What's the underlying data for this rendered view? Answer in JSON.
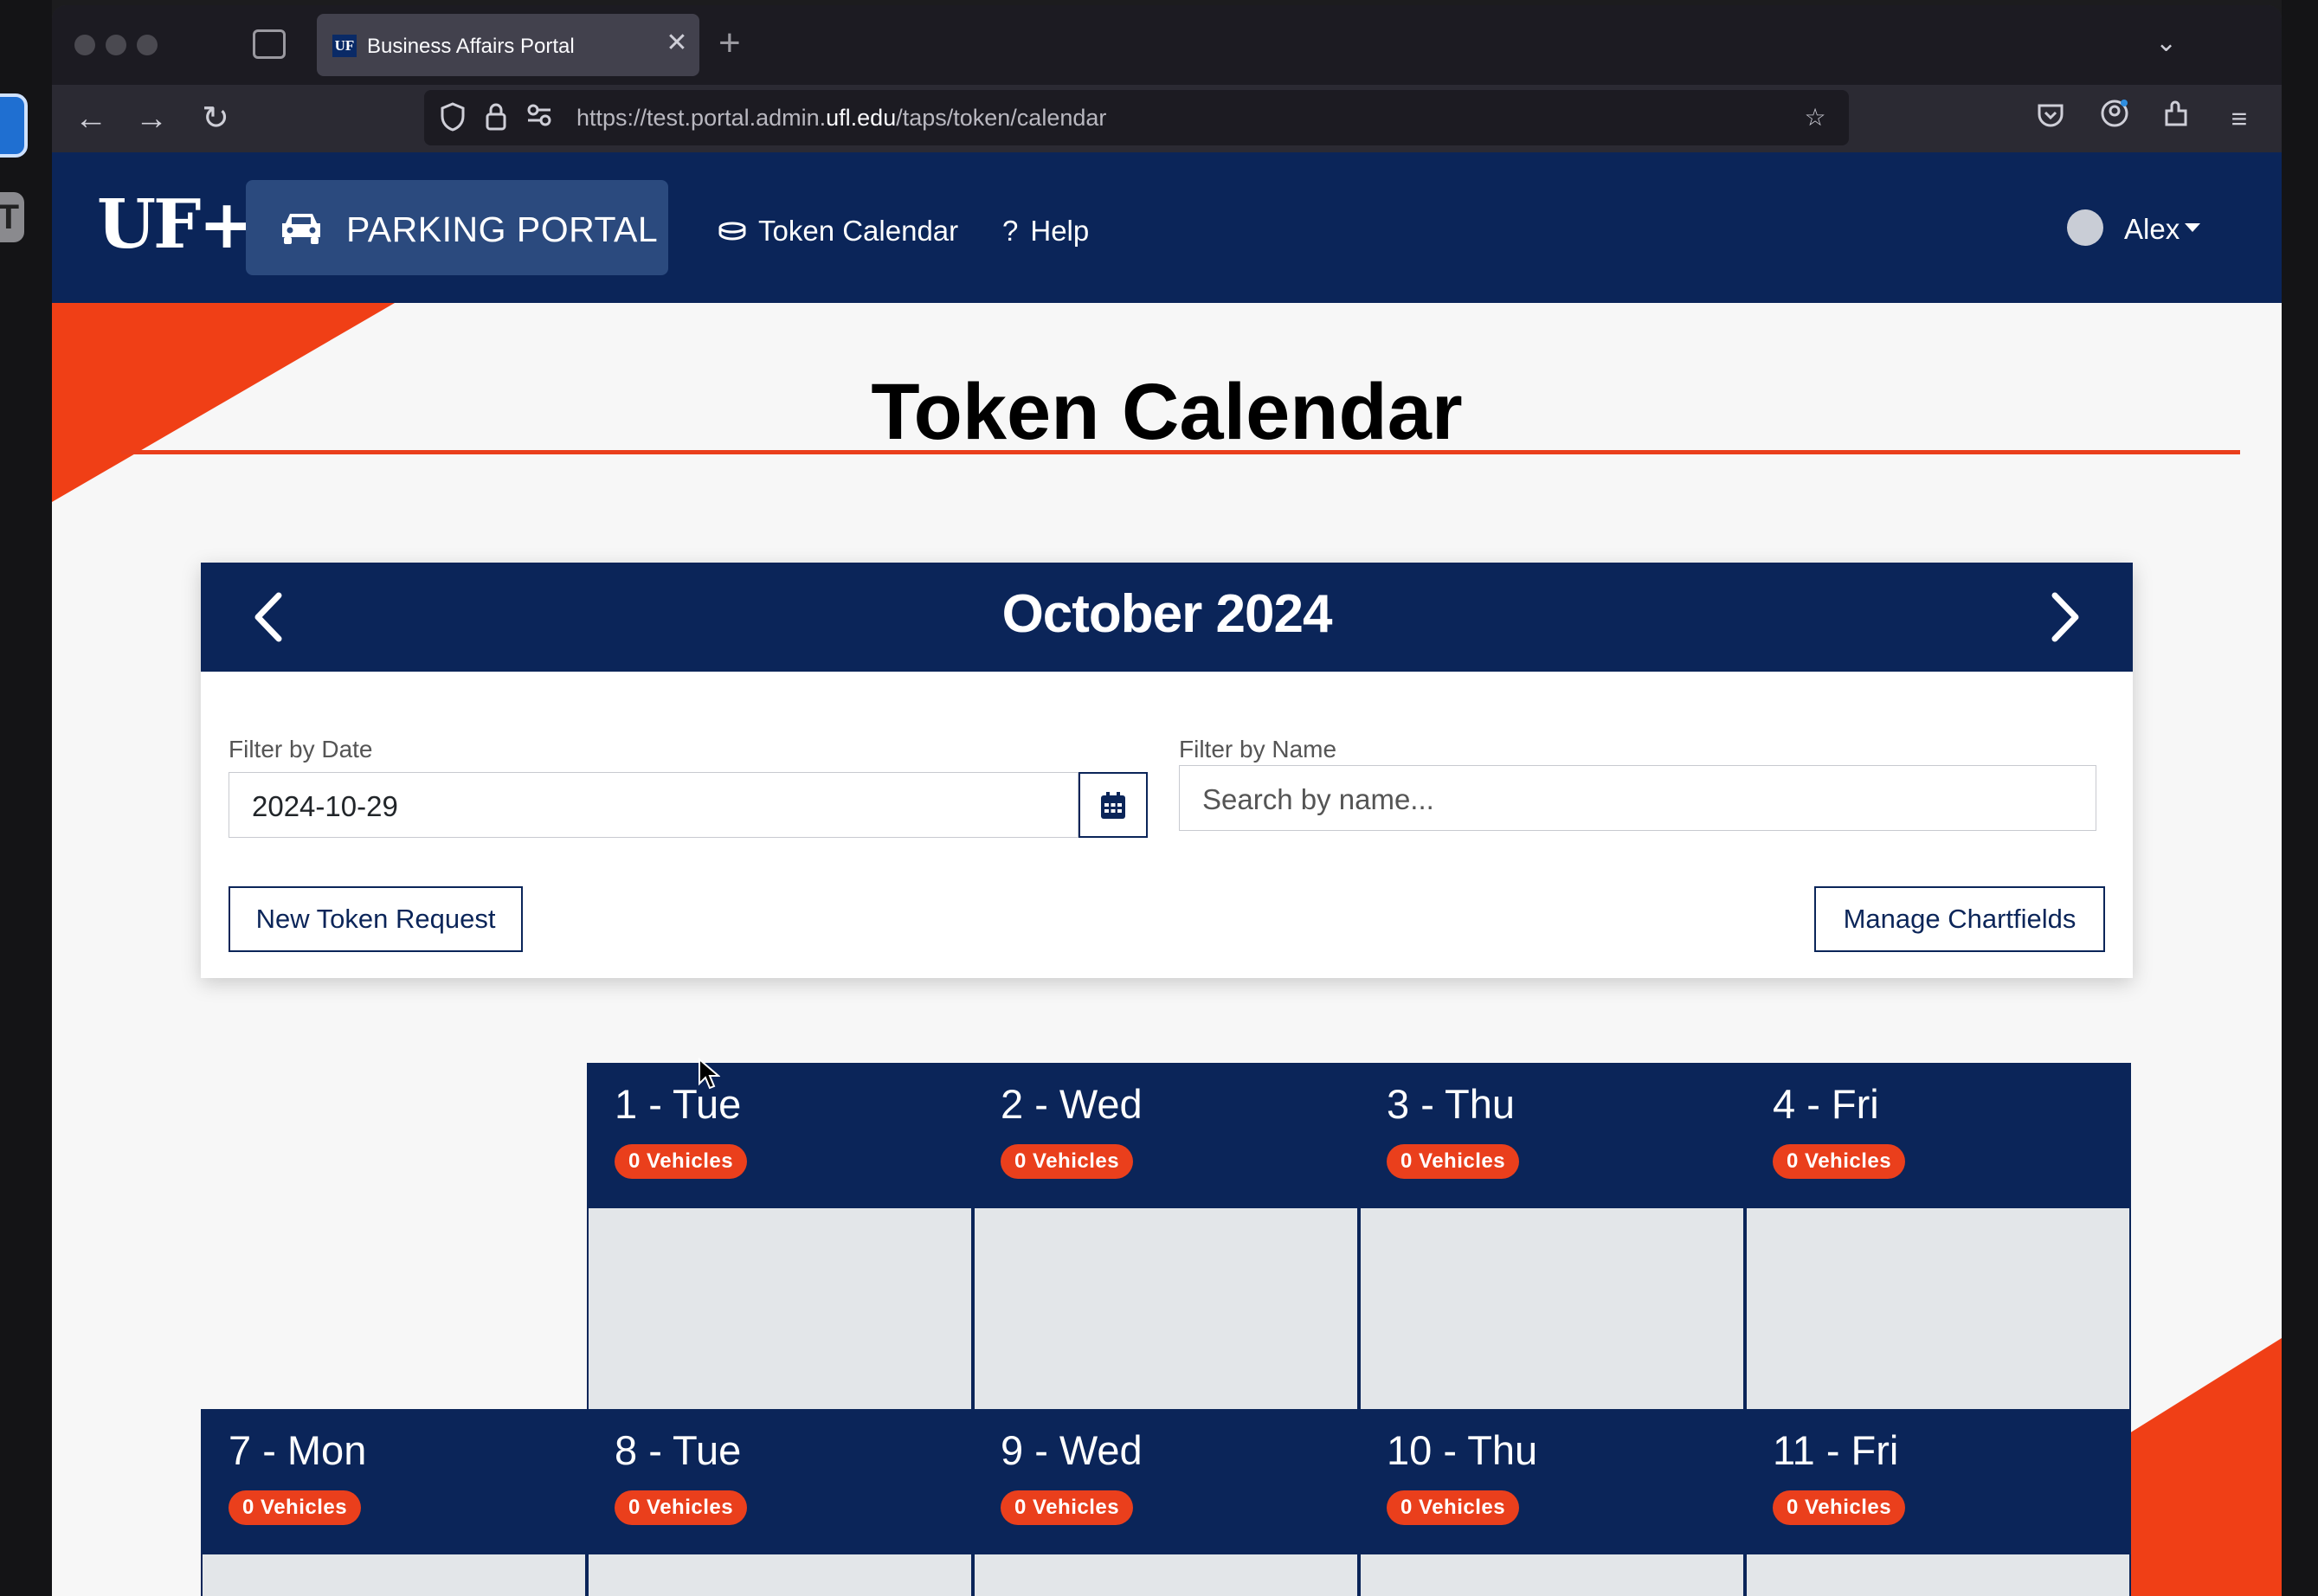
{
  "browser": {
    "tab_title": "Business Affairs Portal",
    "tab_favicon": "UF",
    "url_prefix": "https://test.portal.admin.",
    "url_domain": "ufl.edu",
    "url_path": "/taps/token/calendar"
  },
  "header": {
    "logo": "UF+",
    "brand_label": "PARKING PORTAL",
    "nav": [
      {
        "label": "Token Calendar",
        "icon": "coins-icon"
      },
      {
        "label": "Help",
        "icon": "question-icon"
      }
    ],
    "user_name": "Alex"
  },
  "page": {
    "title": "Token Calendar"
  },
  "calendar_controls": {
    "month_label": "October 2024",
    "filter_date_label": "Filter by Date",
    "filter_date_value": "2024-10-29",
    "filter_name_label": "Filter by Name",
    "filter_name_placeholder": "Search by name...",
    "new_request_label": "New Token Request",
    "manage_chartfields_label": "Manage Chartfields"
  },
  "days": [
    {
      "label": "1 - Tue",
      "badge": "0 Vehicles"
    },
    {
      "label": "2 - Wed",
      "badge": "0 Vehicles"
    },
    {
      "label": "3 - Thu",
      "badge": "0 Vehicles"
    },
    {
      "label": "4 - Fri",
      "badge": "0 Vehicles"
    },
    {
      "label": "7 - Mon",
      "badge": "0 Vehicles"
    },
    {
      "label": "8 - Tue",
      "badge": "0 Vehicles"
    },
    {
      "label": "9 - Wed",
      "badge": "0 Vehicles"
    },
    {
      "label": "10 - Thu",
      "badge": "0 Vehicles"
    },
    {
      "label": "11 - Fri",
      "badge": "0 Vehicles"
    }
  ],
  "colors": {
    "navy": "#0b2559",
    "orange": "#ea3f1c",
    "cell_bg": "#e3e6e9"
  }
}
